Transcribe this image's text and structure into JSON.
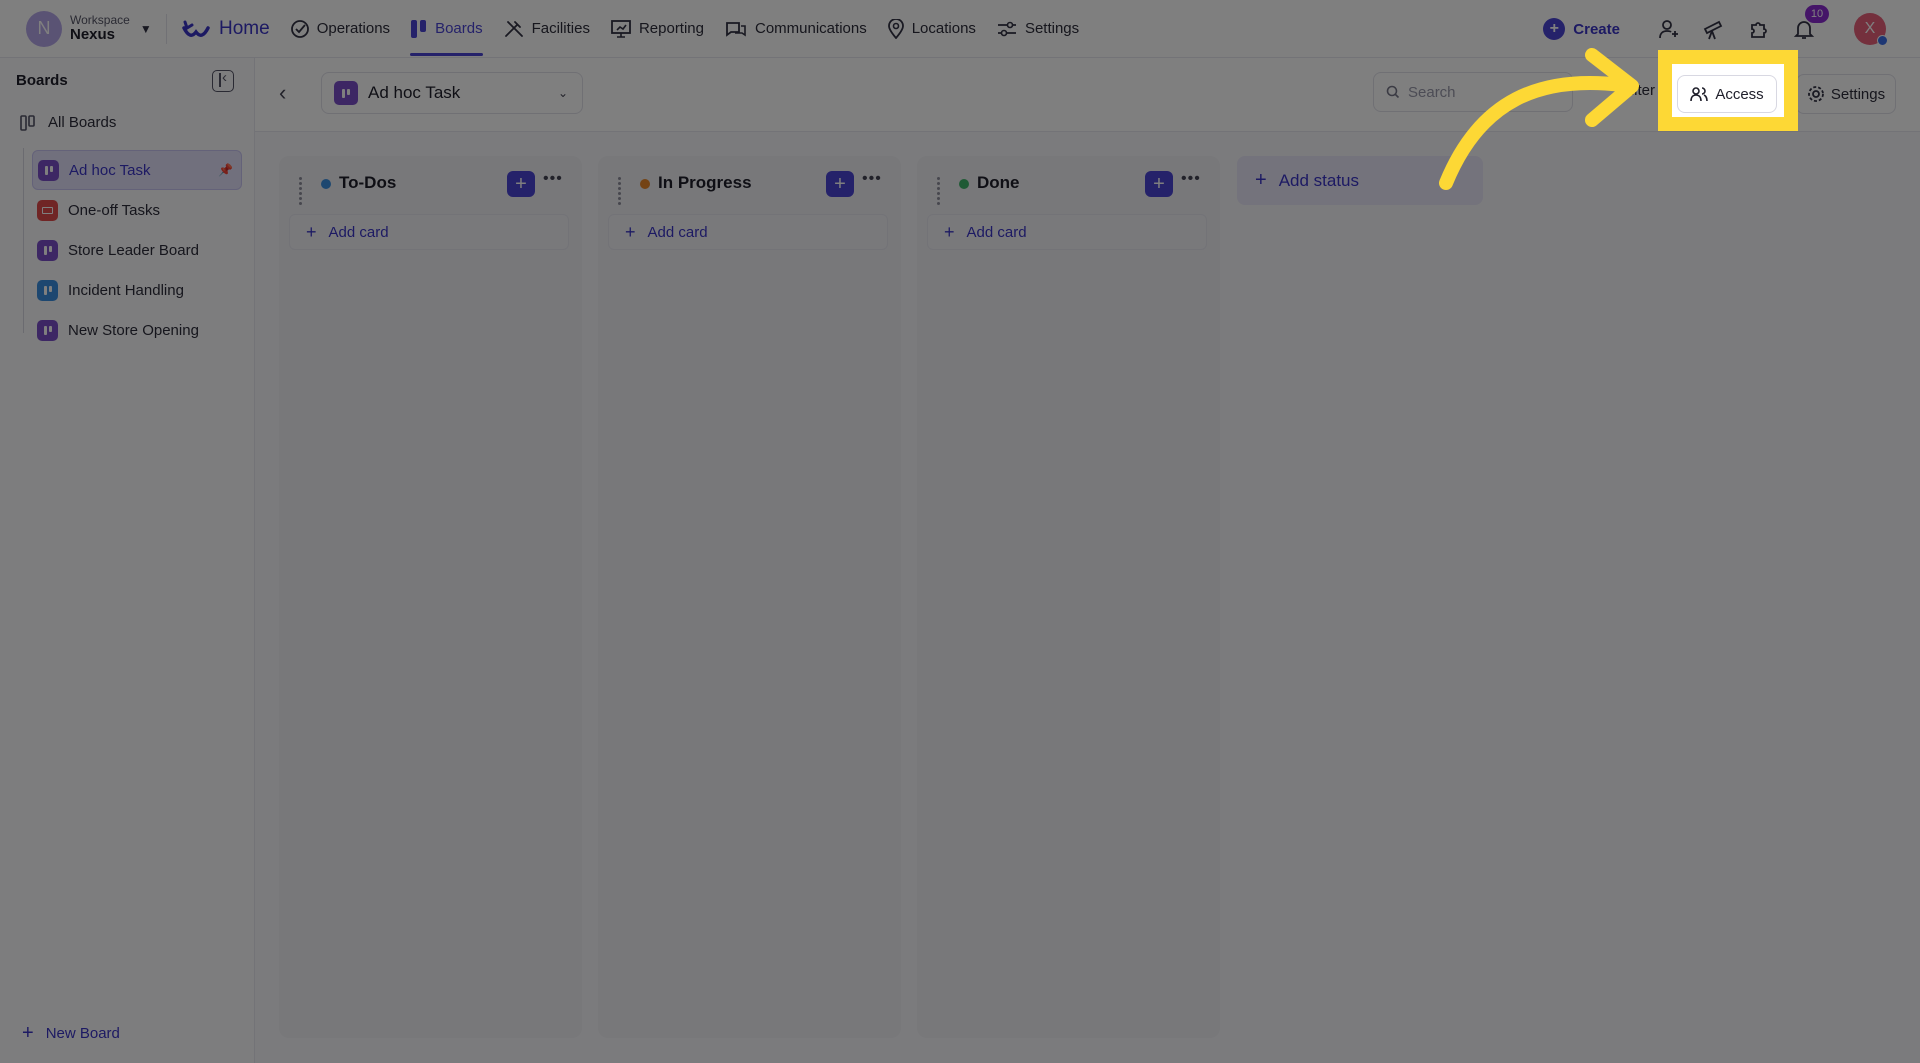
{
  "workspace": {
    "small_label": "Workspace",
    "name": "Nexus",
    "initial": "N"
  },
  "topnav": {
    "home": "Home",
    "items": [
      "Operations",
      "Boards",
      "Facilities",
      "Reporting",
      "Communications",
      "Locations",
      "Settings"
    ],
    "active": "Boards",
    "create": "Create",
    "notifications_count": "10",
    "user_initial": "X"
  },
  "sidebar": {
    "title": "Boards",
    "all_boards": "All Boards",
    "boards": [
      {
        "label": "Ad hoc Task",
        "color": "#7b4fc9",
        "pinned": true
      },
      {
        "label": "One-off Tasks",
        "color": "#e04b4b"
      },
      {
        "label": "Store Leader Board",
        "color": "#7b4fc9"
      },
      {
        "label": "Incident Handling",
        "color": "#3b8fe0"
      },
      {
        "label": "New Store Opening",
        "color": "#7b4fc9"
      }
    ],
    "new_board": "New Board"
  },
  "header": {
    "board_name": "Ad hoc Task",
    "search_placeholder": "Search",
    "filter_label": "Filter",
    "access_label": "Access",
    "settings_label": "Settings"
  },
  "columns": [
    {
      "title": "To-Dos",
      "dot_color": "#3b8fe0",
      "add_card": "Add card"
    },
    {
      "title": "In Progress",
      "dot_color": "#e8862a",
      "add_card": "Add card"
    },
    {
      "title": "Done",
      "dot_color": "#3fb56a",
      "add_card": "Add card"
    }
  ],
  "add_status": "Add status",
  "colors": {
    "accent": "#4a44d4",
    "highlight": "#fdd835"
  }
}
